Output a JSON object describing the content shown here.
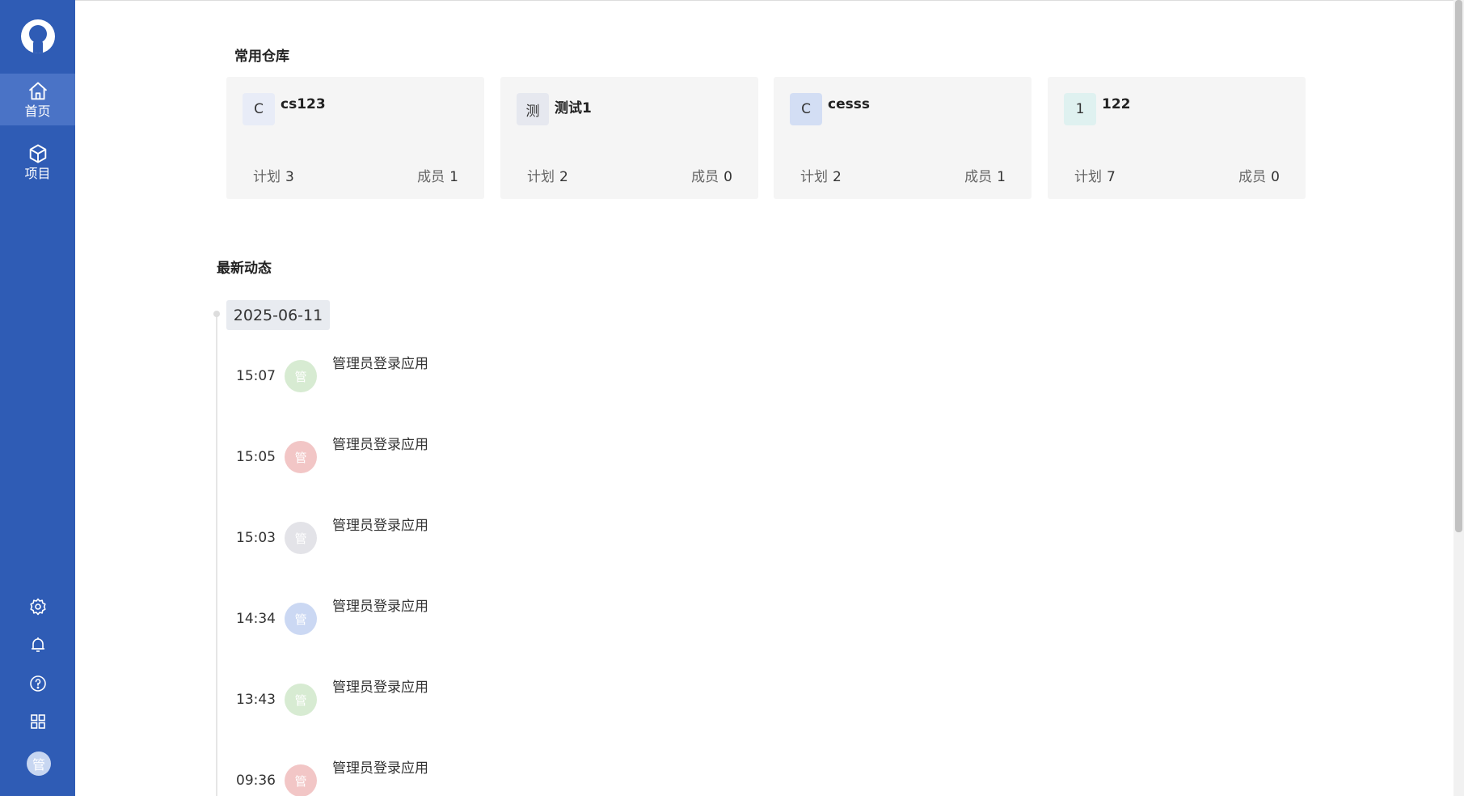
{
  "sidebar": {
    "nav": [
      {
        "label": "首页",
        "icon": "home-icon",
        "active": true
      },
      {
        "label": "项目",
        "icon": "cube-icon",
        "active": false
      }
    ],
    "bottom_icons": [
      "settings-icon",
      "bell-icon",
      "help-icon",
      "apps-grid-icon"
    ],
    "user_avatar": "管"
  },
  "repos": {
    "title": "常用仓库",
    "items": [
      {
        "badge": "C",
        "badge_color": "#e8ecf7",
        "name": "cs123",
        "plan_label": "计划",
        "plan": "3",
        "member_label": "成员",
        "member": "1"
      },
      {
        "badge": "测",
        "badge_color": "#e6e8ef",
        "name": "测试1",
        "plan_label": "计划",
        "plan": "2",
        "member_label": "成员",
        "member": "0"
      },
      {
        "badge": "C",
        "badge_color": "#d3def4",
        "name": "cesss",
        "plan_label": "计划",
        "plan": "2",
        "member_label": "成员",
        "member": "1"
      },
      {
        "badge": "1",
        "badge_color": "#dff1f0",
        "name": "122",
        "plan_label": "计划",
        "plan": "7",
        "member_label": "成员",
        "member": "0"
      }
    ]
  },
  "activity": {
    "title": "最新动态",
    "date": "2025-06-11",
    "events": [
      {
        "time": "15:07",
        "avatar": "管",
        "avatar_color": "#d7ebd2",
        "text": "管理员登录应用"
      },
      {
        "time": "15:05",
        "avatar": "管",
        "avatar_color": "#f2c6c6",
        "text": "管理员登录应用"
      },
      {
        "time": "15:03",
        "avatar": "管",
        "avatar_color": "#e3e3e8",
        "text": "管理员登录应用"
      },
      {
        "time": "14:34",
        "avatar": "管",
        "avatar_color": "#cbd8f3",
        "text": "管理员登录应用"
      },
      {
        "time": "13:43",
        "avatar": "管",
        "avatar_color": "#d7ebd2",
        "text": "管理员登录应用"
      },
      {
        "time": "09:36",
        "avatar": "管",
        "avatar_color": "#f2c6c6",
        "text": "管理员登录应用"
      }
    ]
  },
  "colors": {
    "sidebar": "#2f5cb5",
    "sidebar_active": "#4a73c6"
  }
}
